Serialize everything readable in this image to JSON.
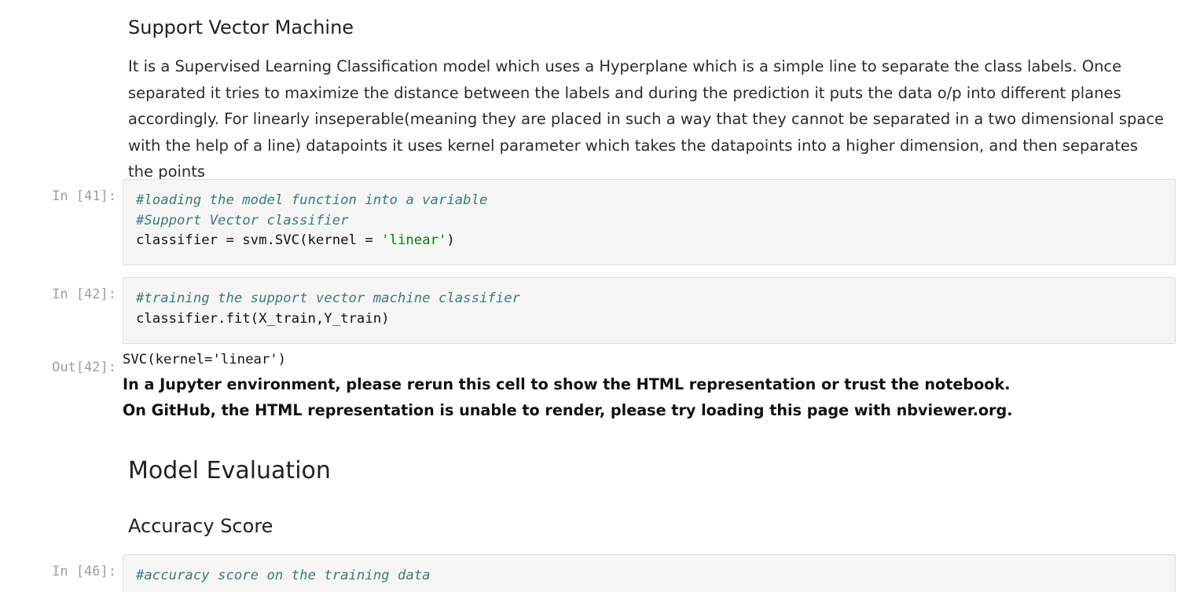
{
  "svm_section": {
    "title": "Support Vector Machine",
    "description": "It is a Supervised Learning Classification model which uses a Hyperplane which is a simple line to separate the class labels. Once separated it tries to maximize the distance between the labels and during the prediction it puts the data o/p into different planes accordingly. For linearly inseperable(meaning they are placed in such a way that they cannot be separated in a two dimensional space with the help of a line) datapoints it uses kernel parameter which takes the datapoints into a higher dimension, and then separates the points"
  },
  "cells": {
    "c41": {
      "prompt": "In [41]:",
      "comment1": "#loading the model function into a variable",
      "comment2": "#Support Vector classifier",
      "code_pre": "classifier = svm.SVC(kernel = ",
      "code_str": "'linear'",
      "code_post": ")"
    },
    "c42": {
      "prompt": "In [42]:",
      "comment1": "#training the support vector machine classifier",
      "code": "classifier.fit(X_train,Y_train)",
      "out_prompt": "Out[42]:",
      "out_text": "SVC(kernel='linear')",
      "warn1": "In a Jupyter environment, please rerun this cell to show the HTML representation or trust the notebook.",
      "warn2": "On GitHub, the HTML representation is unable to render, please try loading this page with nbviewer.org."
    },
    "c46": {
      "prompt": "In [46]:",
      "comment1": "#accuracy score on the training data"
    }
  },
  "eval_section": {
    "title": "Model Evaluation",
    "subtitle": "Accuracy Score"
  },
  "colors": {
    "comment": "#3d7a7a",
    "string": "#0b7a0b",
    "prompt": "#9e9e9e",
    "code_bg": "#f5f5f5"
  }
}
